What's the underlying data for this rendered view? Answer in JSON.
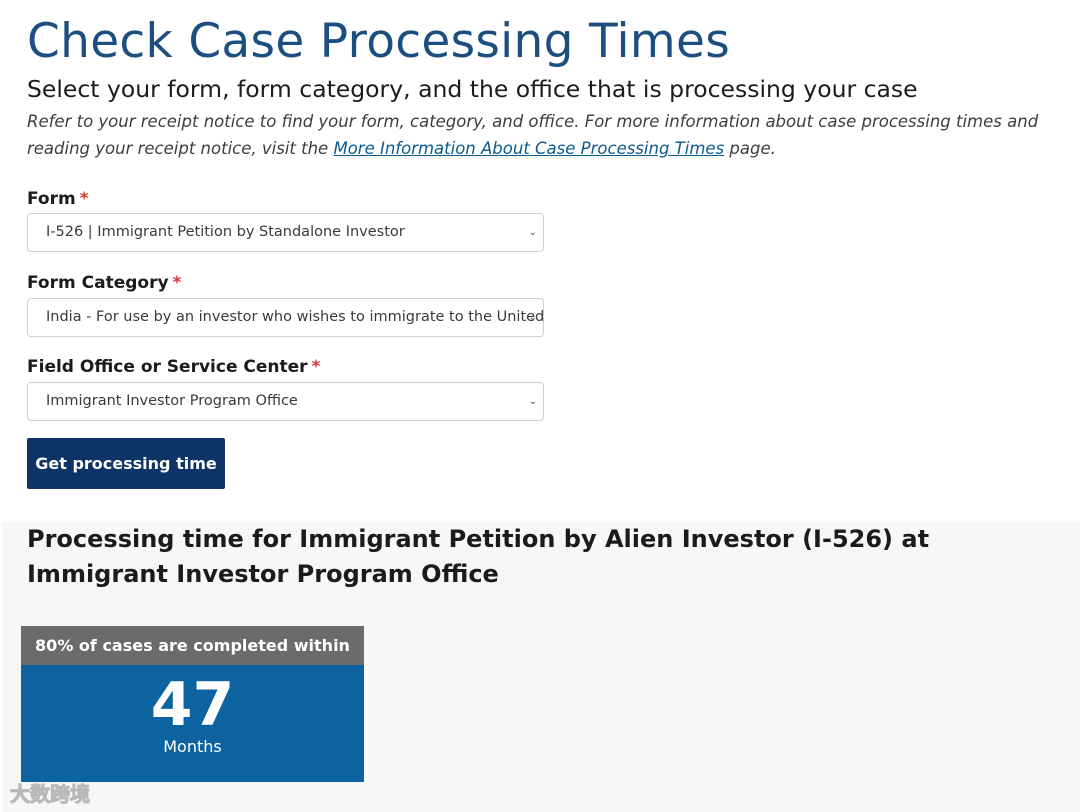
{
  "header": {
    "title": "Check Case Processing Times",
    "subtitle": "Select your form, form category, and the office that is processing your case",
    "intro_before": "Refer to your receipt notice to find your form, category, and office. For more information about case processing times and reading your receipt notice, visit the ",
    "intro_link": "More Information About Case Processing Times",
    "intro_after": " page."
  },
  "form": {
    "form_label": "Form",
    "form_value": "I-526 | Immigrant Petition by Standalone Investor",
    "category_label": "Form Category",
    "category_value": "India - For use by an investor who wishes to immigrate to the United States",
    "office_label": "Field Office or Service Center",
    "office_value": "Immigrant Investor Program Office",
    "required_mark": "*",
    "submit_label": "Get processing time"
  },
  "result": {
    "title": "Processing time for Immigrant Petition by Alien Investor (I-526) at Immigrant Investor Program Office",
    "card_header": "80% of cases are completed within",
    "value": "47",
    "unit": "Months"
  },
  "watermark": "大数跨境",
  "icons": {
    "dropdown": "chevron-down-icon"
  },
  "colors": {
    "title": "#1c4e80",
    "button": "#0e3366",
    "card_body": "#0c63a0",
    "card_head": "#6b6b6b",
    "required": "#d83933"
  }
}
